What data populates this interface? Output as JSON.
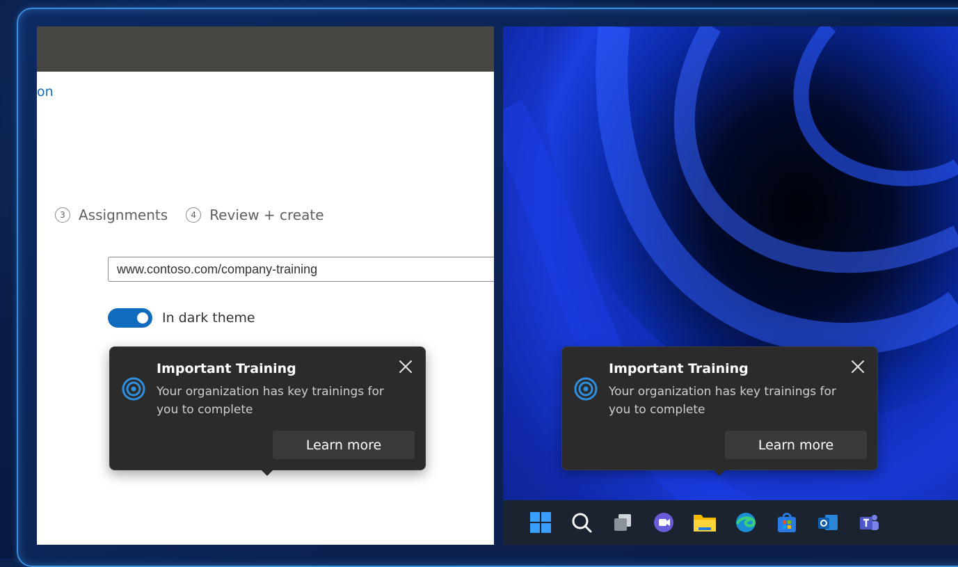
{
  "left": {
    "crumb": "on",
    "steps": [
      {
        "num": "3",
        "label": "Assignments"
      },
      {
        "num": "4",
        "label": "Review + create"
      }
    ],
    "url_value": "www.contoso.com/company-training",
    "toggle_label": "In dark theme",
    "toggle_on": true
  },
  "toast": {
    "title": "Important Training",
    "body": "Your organization has key trainings for you to complete",
    "button": "Learn more"
  },
  "taskbar": {
    "icons": [
      "windows-start-icon",
      "search-icon",
      "task-view-icon",
      "chat-icon",
      "file-explorer-icon",
      "edge-icon",
      "store-icon",
      "outlook-icon",
      "teams-icon"
    ]
  },
  "colors": {
    "accent": "#0f6cbd",
    "toast_bg": "#2b2b2b",
    "frame_border": "#3a8fe0"
  }
}
